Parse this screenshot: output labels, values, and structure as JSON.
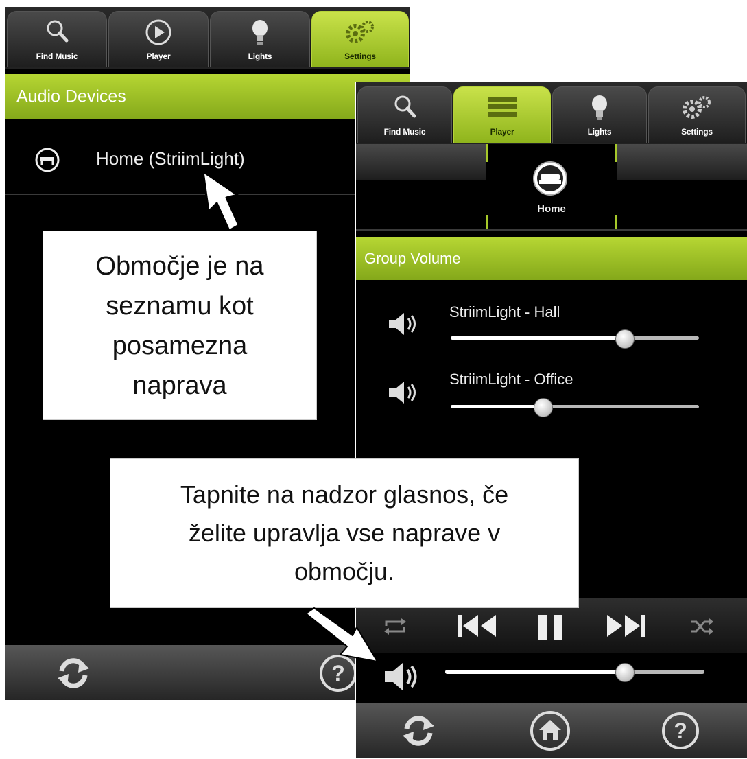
{
  "left_screen": {
    "tabs": [
      {
        "label": "Find Music",
        "icon": "search-icon",
        "active": false
      },
      {
        "label": "Player",
        "icon": "play-icon",
        "active": false
      },
      {
        "label": "Lights",
        "icon": "lightbulb-icon",
        "active": false
      },
      {
        "label": "Settings",
        "icon": "gears-icon",
        "active": true
      }
    ],
    "section_title": "Audio Devices",
    "device": {
      "icon": "sofa-icon",
      "label": "Home (StriimLight)"
    },
    "bottom": {
      "refresh_icon": "refresh-icon",
      "help_icon": "help-icon"
    }
  },
  "right_screen": {
    "tabs": [
      {
        "label": "Find Music",
        "icon": "search-icon",
        "active": false
      },
      {
        "label": "Player",
        "icon": "list-icon",
        "active": true
      },
      {
        "label": "Lights",
        "icon": "lightbulb-icon",
        "active": false
      },
      {
        "label": "Settings",
        "icon": "gears-icon",
        "active": false
      }
    ],
    "zone": {
      "icon": "sofa-icon",
      "label": "Home"
    },
    "section_title": "Group Volume",
    "devices": [
      {
        "name": "StriimLight - Hall",
        "volume": 0.7
      },
      {
        "name": "StriimLight - Office",
        "volume": 0.37
      }
    ],
    "transport": [
      "repeat-icon",
      "previous-icon",
      "pause-icon",
      "next-icon",
      "shuffle-icon"
    ],
    "master_volume": 0.69,
    "bottom": {
      "refresh_icon": "refresh-icon",
      "home_icon": "home-icon",
      "help_icon": "help-icon"
    }
  },
  "callouts": {
    "first": [
      "Območje je na",
      "seznamu kot",
      "posamezna",
      "naprava"
    ],
    "second": [
      "Tapnite na nadzor glasnos, če",
      "želite upravlja vse naprave v",
      "območju."
    ]
  },
  "colors": {
    "accent": "#a6c82a",
    "background": "#000000",
    "callout_bg": "#ffffff"
  }
}
